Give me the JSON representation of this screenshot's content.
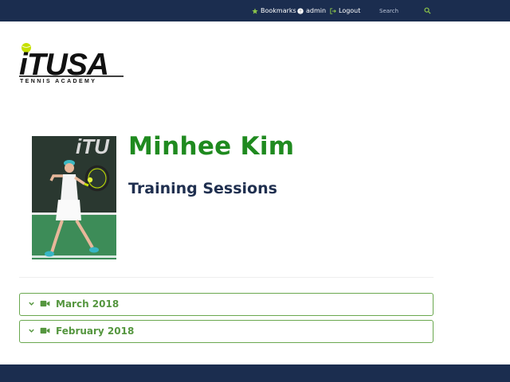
{
  "topnav": {
    "bookmarks_label": "Bookmarks",
    "user_label": "admin",
    "logout_label": "Logout",
    "search_placeholder": "Search"
  },
  "logo": {
    "text": "iTUSA",
    "tagline": "TENNIS ACADEMY"
  },
  "player": {
    "name": "Minhee Kim",
    "subtitle": "Training Sessions",
    "photo_alt": "Minhee Kim"
  },
  "sessions": [
    {
      "label": "March 2018"
    },
    {
      "label": "February 2018"
    }
  ],
  "colors": {
    "navbar": "#1b2d4f",
    "accent_green": "#1f8a1f",
    "accordion_border": "#6aa84f",
    "accordion_text": "#55963f",
    "subtitle": "#1f2f4f"
  }
}
